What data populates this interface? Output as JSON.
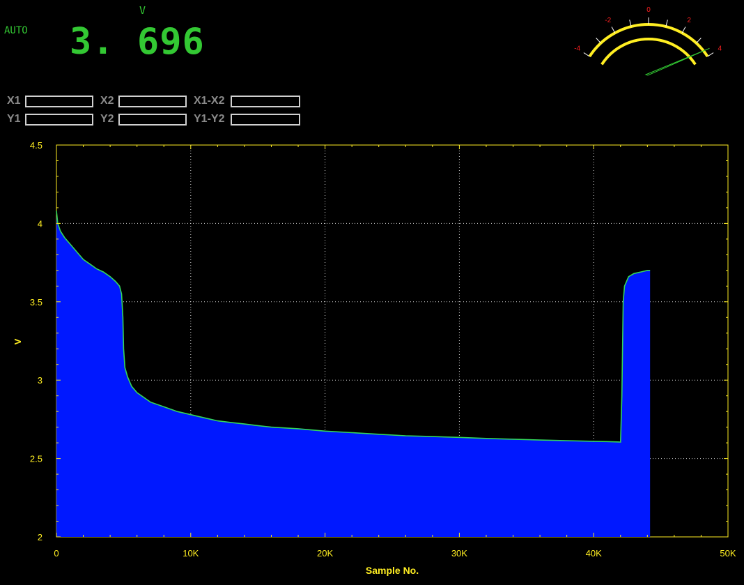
{
  "meter": {
    "mode": "AUTO",
    "unit": "V",
    "reading": "3. 696"
  },
  "cursors": {
    "x1_label": "X1",
    "x2_label": "X2",
    "xdiff_label": "X1-X2",
    "y1_label": "Y1",
    "y2_label": "Y2",
    "ydiff_label": "Y1-Y2",
    "x1_value": "",
    "x2_value": "",
    "xdiff_value": "",
    "y1_value": "",
    "y2_value": "",
    "ydiff_value": ""
  },
  "gauge": {
    "tick_labels": [
      "-4",
      "-2",
      "0",
      "2",
      "4"
    ],
    "needle_value": 3.696,
    "scale_min": -4,
    "scale_max": 4,
    "arc_color": "#ffee22",
    "label_color": "#ff2020",
    "needle_color": "#33c833"
  },
  "colors": {
    "accent": "#33c833",
    "axis": "#ffee22",
    "fill": "#0018ff",
    "trace": "#33d65a"
  },
  "chart_data": {
    "type": "area",
    "title": "",
    "xlabel": "Sample No.",
    "ylabel": "V",
    "xlim": [
      0,
      50000
    ],
    "ylim": [
      2,
      4.5
    ],
    "x_ticks": [
      {
        "value": 0,
        "label": "0"
      },
      {
        "value": 10000,
        "label": "10K"
      },
      {
        "value": 20000,
        "label": "20K"
      },
      {
        "value": 30000,
        "label": "30K"
      },
      {
        "value": 40000,
        "label": "40K"
      },
      {
        "value": 50000,
        "label": "50K"
      }
    ],
    "y_ticks": [
      {
        "value": 2,
        "label": "2"
      },
      {
        "value": 2.5,
        "label": "2.5"
      },
      {
        "value": 3,
        "label": "3"
      },
      {
        "value": 3.5,
        "label": "3.5"
      },
      {
        "value": 4,
        "label": "4"
      },
      {
        "value": 4.5,
        "label": "4.5"
      }
    ],
    "grid": true,
    "series": [
      {
        "points": [
          [
            0,
            4.08
          ],
          [
            100,
            4.0
          ],
          [
            300,
            3.95
          ],
          [
            600,
            3.91
          ],
          [
            1000,
            3.87
          ],
          [
            1500,
            3.82
          ],
          [
            2000,
            3.77
          ],
          [
            2500,
            3.74
          ],
          [
            3000,
            3.71
          ],
          [
            3500,
            3.69
          ],
          [
            4000,
            3.66
          ],
          [
            4400,
            3.63
          ],
          [
            4700,
            3.6
          ],
          [
            4850,
            3.55
          ],
          [
            4950,
            3.4
          ],
          [
            5000,
            3.2
          ],
          [
            5100,
            3.08
          ],
          [
            5300,
            3.02
          ],
          [
            5600,
            2.96
          ],
          [
            6000,
            2.92
          ],
          [
            7000,
            2.86
          ],
          [
            8000,
            2.83
          ],
          [
            9000,
            2.8
          ],
          [
            10000,
            2.78
          ],
          [
            11000,
            2.76
          ],
          [
            12000,
            2.74
          ],
          [
            13000,
            2.73
          ],
          [
            14000,
            2.72
          ],
          [
            15000,
            2.71
          ],
          [
            16000,
            2.7
          ],
          [
            18000,
            2.69
          ],
          [
            20000,
            2.675
          ],
          [
            22000,
            2.665
          ],
          [
            24000,
            2.655
          ],
          [
            26000,
            2.645
          ],
          [
            28000,
            2.64
          ],
          [
            30000,
            2.635
          ],
          [
            32000,
            2.628
          ],
          [
            34000,
            2.623
          ],
          [
            36000,
            2.618
          ],
          [
            38000,
            2.614
          ],
          [
            40000,
            2.61
          ],
          [
            41000,
            2.608
          ],
          [
            42000,
            2.605
          ],
          [
            42100,
            2.9
          ],
          [
            42200,
            3.5
          ],
          [
            42300,
            3.6
          ],
          [
            42600,
            3.66
          ],
          [
            43000,
            3.68
          ],
          [
            43500,
            3.69
          ],
          [
            44000,
            3.7
          ],
          [
            44200,
            3.7
          ]
        ]
      }
    ]
  }
}
